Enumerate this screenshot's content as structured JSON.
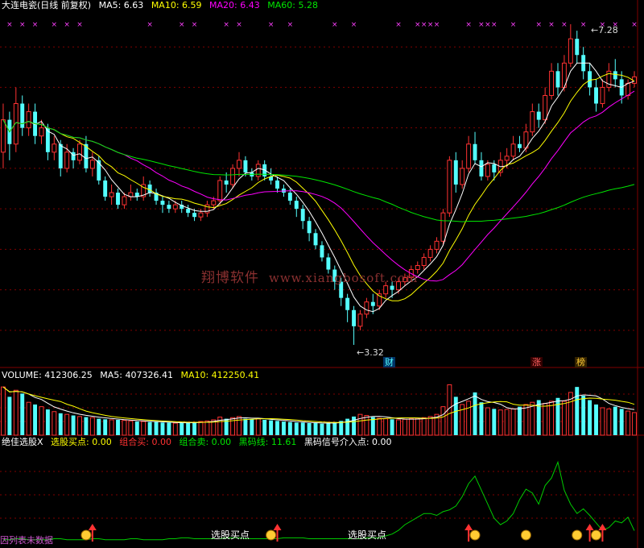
{
  "price_header": {
    "title": "大连电瓷(日线 前复权)",
    "ma5": "MA5: 6.63",
    "ma10": "MA10: 6.59",
    "ma20": "MA20: 6.43",
    "ma60": "MA60: 5.28"
  },
  "volume_header": {
    "title": "VOLUME: 412306.25",
    "ma5": "MA5: 407326.41",
    "ma10": "MA10: 412250.41"
  },
  "indicator_header": {
    "title": "绝佳选股X",
    "buy": "选股买点: 0.00",
    "combo_buy": "组合买: 0.00",
    "combo_sell": "组合卖: 0.00",
    "black_code": "黑码线: 11.61",
    "signal": "黑码信号介入点: 0.00"
  },
  "watermark": {
    "cn": "翔博软件",
    "url": "www.xiangbosoft.com"
  },
  "annotations": {
    "low": "3.32",
    "high": "7.28",
    "cai": "财",
    "zhang": "涨",
    "bang": "榜"
  },
  "signal_labels": {
    "first": "选股买点",
    "second": "选股买点"
  },
  "no_data_text": "因列表未数据",
  "colors": {
    "up": "#ff3232",
    "down": "#54ffff",
    "ma5": "#ffffff",
    "ma10": "#ffff00",
    "ma20": "#ff00ff",
    "ma60": "#00e600",
    "grid": "#800000",
    "ind": "#00cc00"
  },
  "chart_data": {
    "type": "candlestick",
    "n_bars": 100,
    "price": {
      "high_label": 7.28,
      "low_label": 3.32,
      "ylim": [
        3.2,
        7.4
      ],
      "bars": [
        [
          5.7,
          6.1,
          5.5,
          6.3
        ],
        [
          6.1,
          5.8,
          5.6,
          6.2
        ],
        [
          5.8,
          6.3,
          5.7,
          6.5
        ],
        [
          6.3,
          6.0,
          5.9,
          6.4
        ],
        [
          6.0,
          6.2,
          5.9,
          6.3
        ],
        [
          6.2,
          5.9,
          5.8,
          6.3
        ],
        [
          5.9,
          6.0,
          5.8,
          6.1
        ],
        [
          6.0,
          5.7,
          5.6,
          6.05
        ],
        [
          5.7,
          5.8,
          5.6,
          5.9
        ],
        [
          5.8,
          5.5,
          5.4,
          5.85
        ],
        [
          5.5,
          5.7,
          5.45,
          5.8
        ],
        [
          5.7,
          5.6,
          5.5,
          5.75
        ],
        [
          5.6,
          5.8,
          5.55,
          5.85
        ],
        [
          5.8,
          5.5,
          5.45,
          5.9
        ],
        [
          5.5,
          5.6,
          5.4,
          5.7
        ],
        [
          5.6,
          5.35,
          5.3,
          5.65
        ],
        [
          5.35,
          5.15,
          5.1,
          5.4
        ],
        [
          5.15,
          5.2,
          5.05,
          5.3
        ],
        [
          5.2,
          5.05,
          5.0,
          5.25
        ],
        [
          5.05,
          5.15,
          5.0,
          5.2
        ],
        [
          5.15,
          5.2,
          5.1,
          5.3
        ],
        [
          5.2,
          5.15,
          5.1,
          5.25
        ],
        [
          5.15,
          5.3,
          5.1,
          5.4
        ],
        [
          5.3,
          5.2,
          5.15,
          5.35
        ],
        [
          5.2,
          5.1,
          5.05,
          5.25
        ],
        [
          5.1,
          5.05,
          4.95,
          5.15
        ],
        [
          5.05,
          5.0,
          4.95,
          5.1
        ],
        [
          5.0,
          5.05,
          4.95,
          5.1
        ],
        [
          5.05,
          5.0,
          4.95,
          5.1
        ],
        [
          5.0,
          4.95,
          4.9,
          5.05
        ],
        [
          4.95,
          4.9,
          4.85,
          5.0
        ],
        [
          4.9,
          4.95,
          4.85,
          5.0
        ],
        [
          4.95,
          5.05,
          4.9,
          5.1
        ],
        [
          5.05,
          5.1,
          5.0,
          5.15
        ],
        [
          5.1,
          5.35,
          5.05,
          5.4
        ],
        [
          5.35,
          5.3,
          5.2,
          5.45
        ],
        [
          5.3,
          5.5,
          5.25,
          5.55
        ],
        [
          5.5,
          5.6,
          5.4,
          5.7
        ],
        [
          5.6,
          5.45,
          5.4,
          5.65
        ],
        [
          5.45,
          5.4,
          5.35,
          5.5
        ],
        [
          5.4,
          5.55,
          5.35,
          5.6
        ],
        [
          5.55,
          5.4,
          5.35,
          5.6
        ],
        [
          5.4,
          5.35,
          5.3,
          5.5
        ],
        [
          5.35,
          5.25,
          5.2,
          5.4
        ],
        [
          5.25,
          5.2,
          5.15,
          5.3
        ],
        [
          5.2,
          5.1,
          5.05,
          5.25
        ],
        [
          5.1,
          5.0,
          4.9,
          5.15
        ],
        [
          5.0,
          4.85,
          4.75,
          5.05
        ],
        [
          4.85,
          4.7,
          4.6,
          4.9
        ],
        [
          4.7,
          4.55,
          4.5,
          4.75
        ],
        [
          4.55,
          4.4,
          4.35,
          4.6
        ],
        [
          4.4,
          4.25,
          4.2,
          4.45
        ],
        [
          4.25,
          4.1,
          4.0,
          4.3
        ],
        [
          4.1,
          3.9,
          3.8,
          4.15
        ],
        [
          3.9,
          3.75,
          3.6,
          3.95
        ],
        [
          3.75,
          3.55,
          3.32,
          3.8
        ],
        [
          3.55,
          3.7,
          3.5,
          3.75
        ],
        [
          3.7,
          3.85,
          3.65,
          3.9
        ],
        [
          3.85,
          3.8,
          3.7,
          3.95
        ],
        [
          3.8,
          3.95,
          3.75,
          4.0
        ],
        [
          3.95,
          4.05,
          3.9,
          4.1
        ],
        [
          4.05,
          4.0,
          3.9,
          4.1
        ],
        [
          4.0,
          4.1,
          3.95,
          4.15
        ],
        [
          4.1,
          4.15,
          4.05,
          4.2
        ],
        [
          4.15,
          4.25,
          4.1,
          4.3
        ],
        [
          4.25,
          4.3,
          4.2,
          4.35
        ],
        [
          4.3,
          4.4,
          4.25,
          4.45
        ],
        [
          4.4,
          4.5,
          4.35,
          4.55
        ],
        [
          4.5,
          4.6,
          4.45,
          4.65
        ],
        [
          4.6,
          4.95,
          4.55,
          5.0
        ],
        [
          4.95,
          5.6,
          4.9,
          5.65
        ],
        [
          5.6,
          5.3,
          5.2,
          5.7
        ],
        [
          5.3,
          5.5,
          5.25,
          5.6
        ],
        [
          5.5,
          5.8,
          5.45,
          5.9
        ],
        [
          5.8,
          5.6,
          5.55,
          5.95
        ],
        [
          5.6,
          5.4,
          5.35,
          5.7
        ],
        [
          5.4,
          5.55,
          5.35,
          5.6
        ],
        [
          5.55,
          5.45,
          5.35,
          5.6
        ],
        [
          5.45,
          5.6,
          5.4,
          5.7
        ],
        [
          5.6,
          5.65,
          5.5,
          5.75
        ],
        [
          5.65,
          5.8,
          5.6,
          5.9
        ],
        [
          5.8,
          5.75,
          5.7,
          5.9
        ],
        [
          5.75,
          5.95,
          5.7,
          6.05
        ],
        [
          5.95,
          6.2,
          5.9,
          6.3
        ],
        [
          6.2,
          6.1,
          6.0,
          6.3
        ],
        [
          6.1,
          6.4,
          6.05,
          6.5
        ],
        [
          6.4,
          6.7,
          6.35,
          6.8
        ],
        [
          6.7,
          6.5,
          6.4,
          6.8
        ],
        [
          6.5,
          6.8,
          6.45,
          6.9
        ],
        [
          6.8,
          7.1,
          6.75,
          7.28
        ],
        [
          7.1,
          6.9,
          6.8,
          7.2
        ],
        [
          6.9,
          6.7,
          6.6,
          7.0
        ],
        [
          6.7,
          6.5,
          6.4,
          6.8
        ],
        [
          6.5,
          6.3,
          6.2,
          6.6
        ],
        [
          6.3,
          6.5,
          6.25,
          6.6
        ],
        [
          6.5,
          6.7,
          6.45,
          6.8
        ],
        [
          6.7,
          6.6,
          6.5,
          6.85
        ],
        [
          6.6,
          6.4,
          6.3,
          6.7
        ],
        [
          6.4,
          6.55,
          6.35,
          6.6
        ],
        [
          6.55,
          6.63,
          6.5,
          6.7
        ]
      ]
    },
    "volume": {
      "ylim": [
        0,
        1000000
      ],
      "values": [
        880000,
        700000,
        820000,
        760000,
        600000,
        560000,
        520000,
        470000,
        430000,
        400000,
        380000,
        360000,
        340000,
        330000,
        320000,
        300000,
        290000,
        280000,
        280000,
        270000,
        260000,
        250000,
        250000,
        240000,
        240000,
        230000,
        230000,
        220000,
        220000,
        230000,
        240000,
        250000,
        260000,
        280000,
        330000,
        300000,
        320000,
        340000,
        300000,
        290000,
        300000,
        280000,
        270000,
        260000,
        250000,
        240000,
        230000,
        230000,
        220000,
        220000,
        210000,
        220000,
        240000,
        260000,
        300000,
        340000,
        380000,
        360000,
        330000,
        310000,
        300000,
        290000,
        280000,
        290000,
        300000,
        310000,
        320000,
        340000,
        380000,
        520000,
        920000,
        700000,
        560000,
        620000,
        780000,
        600000,
        500000,
        480000,
        460000,
        470000,
        480000,
        520000,
        560000,
        600000,
        640000,
        580000,
        620000,
        680000,
        620000,
        780000,
        880000,
        720000,
        640000,
        560000,
        500000,
        480000,
        520000,
        480000,
        440000,
        412306
      ]
    },
    "indicator": {
      "ylim": [
        0,
        100
      ],
      "black_code_line": [
        2,
        2,
        3,
        3,
        2,
        2,
        2,
        2,
        3,
        3,
        2,
        2,
        2,
        2,
        3,
        3,
        2,
        2,
        2,
        2,
        3,
        3,
        2,
        2,
        2,
        2,
        3,
        3,
        4,
        4,
        3,
        3,
        3,
        3,
        3,
        4,
        4,
        4,
        3,
        3,
        3,
        3,
        3,
        3,
        4,
        4,
        4,
        4,
        3,
        3,
        3,
        3,
        3,
        3,
        3,
        3,
        3,
        4,
        4,
        4,
        6,
        8,
        12,
        18,
        22,
        26,
        30,
        30,
        28,
        32,
        34,
        38,
        48,
        62,
        70,
        55,
        40,
        25,
        18,
        22,
        30,
        45,
        56,
        52,
        40,
        60,
        68,
        85,
        55,
        40,
        30,
        35,
        28,
        20,
        12,
        15,
        22,
        20,
        26,
        11.61
      ],
      "buy_signals": [
        14,
        43,
        73,
        92,
        94
      ]
    }
  }
}
